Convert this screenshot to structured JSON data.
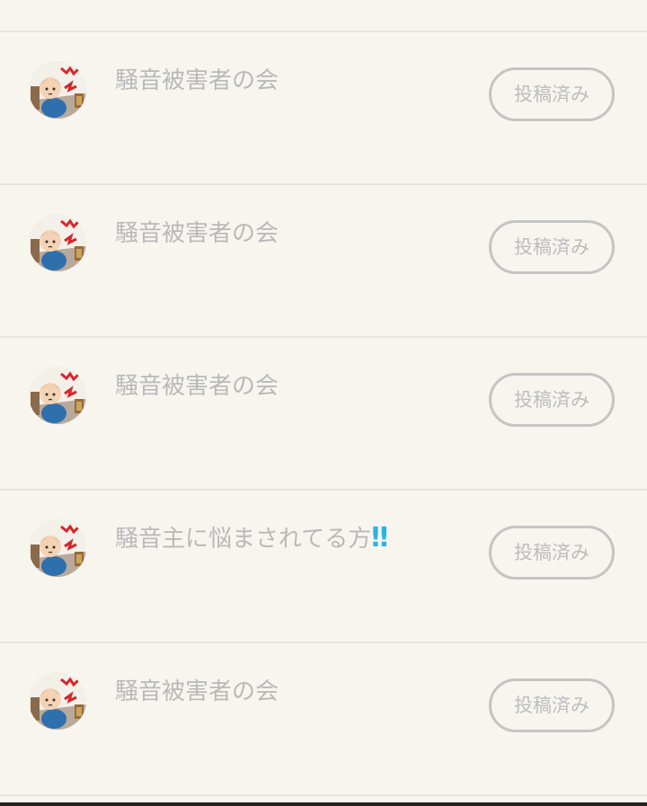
{
  "posts": [
    {
      "title": "騒音被害者の会",
      "title_emph": "",
      "status_label": "投稿済み",
      "avatar_icon": "noise-victim-avatar-icon"
    },
    {
      "title": "騒音被害者の会",
      "title_emph": "",
      "status_label": "投稿済み",
      "avatar_icon": "noise-victim-avatar-icon"
    },
    {
      "title": "騒音被害者の会",
      "title_emph": "",
      "status_label": "投稿済み",
      "avatar_icon": "noise-victim-avatar-icon"
    },
    {
      "title": "騒音主に悩まされてる方",
      "title_emph": "‼",
      "status_label": "投稿済み",
      "avatar_icon": "noise-victim-avatar-icon"
    },
    {
      "title": "騒音被害者の会",
      "title_emph": "",
      "status_label": "投稿済み",
      "avatar_icon": "noise-victim-avatar-icon"
    }
  ],
  "colors": {
    "background": "#f7f5ee",
    "divider": "#e6e4de",
    "text_muted": "#b9b9b9",
    "button_border": "#c4c4c4",
    "emphasis": "#2bb4e4"
  }
}
